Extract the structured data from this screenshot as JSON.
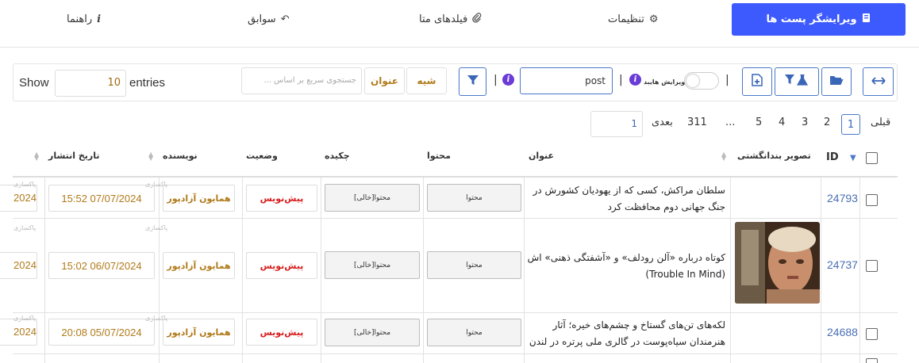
{
  "tabs": {
    "editor": "ویرایشگر پست ها",
    "settings": "تنظیمات",
    "meta_fields": "فیلدهای متا",
    "history": "سوابق",
    "help": "راهنما"
  },
  "toolbar": {
    "show_label": "Show",
    "show_value": "10",
    "entries_label": "entries",
    "quick_search_placeholder": "جستجوی سریع بر اساس ...",
    "field_title": "عنوان",
    "field_mode": "شیه",
    "search_value": "post",
    "advanced_label": "ویرایش هایبد",
    "separator": "|"
  },
  "pagination": {
    "prev": "قبلی",
    "pages": [
      "1",
      "2",
      "3",
      "4",
      "5"
    ],
    "ellipsis": "...",
    "last": "311",
    "next": "بعدی",
    "goto_value": "1",
    "active_page": 1
  },
  "columns": {
    "id": "ID",
    "thumbnail": "تصویر بندانگشتی",
    "title": "عنوان",
    "content": "محتوا",
    "excerpt": "چکیده",
    "status": "وضعیت",
    "author": "نویسنده",
    "publish_date": "تاریخ انتشار"
  },
  "rows": [
    {
      "id": "24793",
      "title": "سلطان مراکش، کسی که از یهودیان کشورش در جنگ جهانی دوم محافظت کرد",
      "content": "محتوا",
      "excerpt": "محتوا[خالی]",
      "status": "پیش‌نویس",
      "author": "همایون آزادپور",
      "date": "15:52 07/07/2024",
      "cut_date": "2024",
      "cut_label": "پاکسازی"
    },
    {
      "id": "24737",
      "title": "کوتاه درباره «آلن رودلف» و «آشفتگی ذهنی» اش (Trouble In Mind)",
      "content": "محتوا",
      "excerpt": "محتوا[خالی]",
      "status": "پیش‌نویس",
      "author": "همایون آزادپور",
      "date": "15:02 06/07/2024",
      "cut_date": "2024",
      "cut_label": "پاکسازی"
    },
    {
      "id": "24688",
      "title": "لکه‌های تن‌های گستاخ و چشم‌های خیره؛ آثار هنرمندان سیاه‌پوست در گالری ملی پرتره در لندن",
      "content": "محتوا",
      "excerpt": "محتوا[خالی]",
      "status": "پیش‌نویس",
      "author": "همایون آزادپور",
      "date": "20:08 05/07/2024",
      "cut_date": "2024",
      "cut_label": "پاکسازی"
    }
  ],
  "colors": {
    "primary": "#3d5afe",
    "accent": "#4a78c8",
    "status_red": "#d81e1e",
    "author_gold": "#b07a1a"
  }
}
